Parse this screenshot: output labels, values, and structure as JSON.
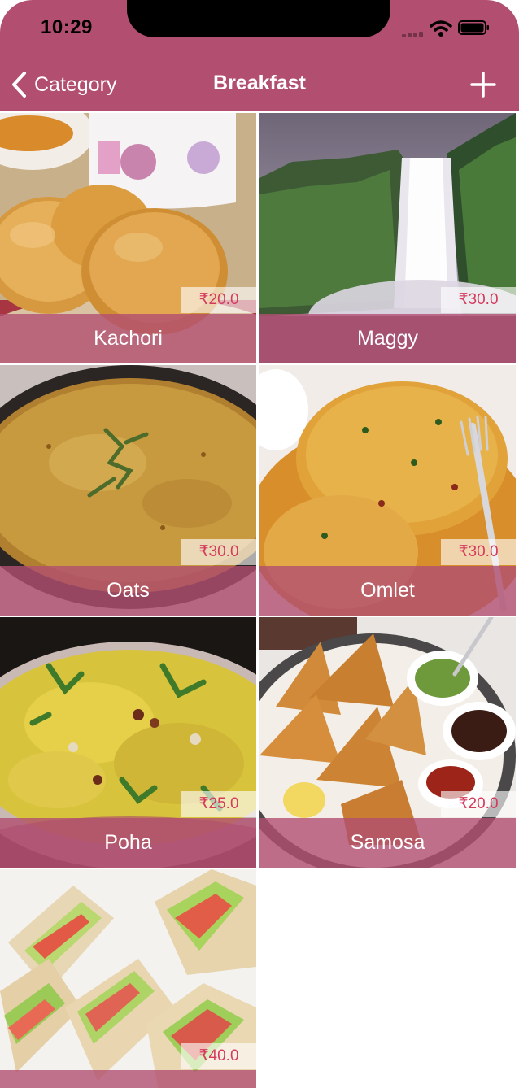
{
  "status_bar": {
    "time": "10:29",
    "icons": [
      "signal-icon",
      "wifi-icon",
      "battery-icon"
    ]
  },
  "nav": {
    "back_label": "Category",
    "title": "Breakfast",
    "back_icon": "chevron-left-icon",
    "add_icon": "plus-icon"
  },
  "colors": {
    "accent": "#b24f70",
    "price_text": "#d43a5d",
    "white": "#ffffff"
  },
  "items": [
    {
      "name": "Kachori",
      "price": "₹20.0",
      "image": "kachori-photo"
    },
    {
      "name": "Maggy",
      "price": "₹30.0",
      "image": "waterfall-photo"
    },
    {
      "name": "Oats",
      "price": "₹30.0",
      "image": "oats-photo"
    },
    {
      "name": "Omlet",
      "price": "₹30.0",
      "image": "omelette-photo"
    },
    {
      "name": "Poha",
      "price": "₹25.0",
      "image": "poha-photo"
    },
    {
      "name": "Samosa",
      "price": "₹20.0",
      "image": "samosa-photo"
    },
    {
      "name": "",
      "price": "₹40.0",
      "image": "sandwich-photo"
    }
  ]
}
